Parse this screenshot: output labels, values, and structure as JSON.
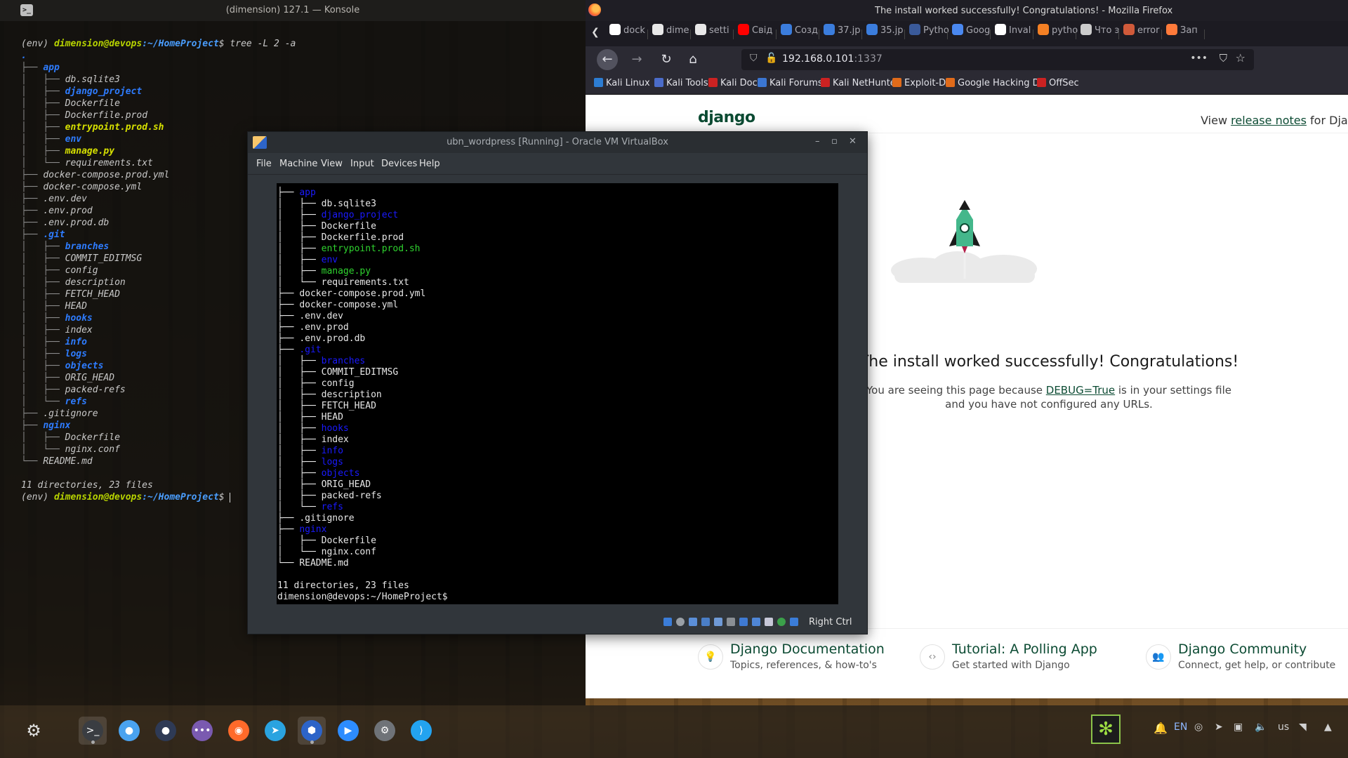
{
  "konsole": {
    "title": "(dimension) 127.1 — Konsole",
    "prompt_env": "(env) ",
    "prompt_user": "dimension@devops",
    "prompt_path": ":~/HomeProject",
    "prompt_sign": "$ ",
    "command": "tree -L 2 -a",
    "tree": [
      {
        "prefix": "",
        "name": ".",
        "kind": "dir"
      },
      {
        "prefix": "├── ",
        "name": "app",
        "kind": "dir"
      },
      {
        "prefix": "│   ├── ",
        "name": "db.sqlite3",
        "kind": "file"
      },
      {
        "prefix": "│   ├── ",
        "name": "django_project",
        "kind": "dir"
      },
      {
        "prefix": "│   ├── ",
        "name": "Dockerfile",
        "kind": "file"
      },
      {
        "prefix": "│   ├── ",
        "name": "Dockerfile.prod",
        "kind": "file"
      },
      {
        "prefix": "│   ├── ",
        "name": "entrypoint.prod.sh",
        "kind": "exec"
      },
      {
        "prefix": "│   ├── ",
        "name": "env",
        "kind": "dir"
      },
      {
        "prefix": "│   ├── ",
        "name": "manage.py",
        "kind": "exec"
      },
      {
        "prefix": "│   └── ",
        "name": "requirements.txt",
        "kind": "file"
      },
      {
        "prefix": "├── ",
        "name": "docker-compose.prod.yml",
        "kind": "file"
      },
      {
        "prefix": "├── ",
        "name": "docker-compose.yml",
        "kind": "file"
      },
      {
        "prefix": "├── ",
        "name": ".env.dev",
        "kind": "file"
      },
      {
        "prefix": "├── ",
        "name": ".env.prod",
        "kind": "file"
      },
      {
        "prefix": "├── ",
        "name": ".env.prod.db",
        "kind": "file"
      },
      {
        "prefix": "├── ",
        "name": ".git",
        "kind": "dir"
      },
      {
        "prefix": "│   ├── ",
        "name": "branches",
        "kind": "dir"
      },
      {
        "prefix": "│   ├── ",
        "name": "COMMIT_EDITMSG",
        "kind": "file"
      },
      {
        "prefix": "│   ├── ",
        "name": "config",
        "kind": "file"
      },
      {
        "prefix": "│   ├── ",
        "name": "description",
        "kind": "file"
      },
      {
        "prefix": "│   ├── ",
        "name": "FETCH_HEAD",
        "kind": "file"
      },
      {
        "prefix": "│   ├── ",
        "name": "HEAD",
        "kind": "file"
      },
      {
        "prefix": "│   ├── ",
        "name": "hooks",
        "kind": "dir"
      },
      {
        "prefix": "│   ├── ",
        "name": "index",
        "kind": "file"
      },
      {
        "prefix": "│   ├── ",
        "name": "info",
        "kind": "dir"
      },
      {
        "prefix": "│   ├── ",
        "name": "logs",
        "kind": "dir"
      },
      {
        "prefix": "│   ├── ",
        "name": "objects",
        "kind": "dir"
      },
      {
        "prefix": "│   ├── ",
        "name": "ORIG_HEAD",
        "kind": "file"
      },
      {
        "prefix": "│   ├── ",
        "name": "packed-refs",
        "kind": "file"
      },
      {
        "prefix": "│   └── ",
        "name": "refs",
        "kind": "dir"
      },
      {
        "prefix": "├── ",
        "name": ".gitignore",
        "kind": "file"
      },
      {
        "prefix": "├── ",
        "name": "nginx",
        "kind": "dir"
      },
      {
        "prefix": "│   ├── ",
        "name": "Dockerfile",
        "kind": "file"
      },
      {
        "prefix": "│   └── ",
        "name": "nginx.conf",
        "kind": "file"
      },
      {
        "prefix": "└── ",
        "name": "README.md",
        "kind": "file"
      }
    ],
    "summary": "11 directories, 23 files"
  },
  "firefox": {
    "title": "The install worked successfully! Congratulations! - Mozilla Firefox",
    "tabs": [
      {
        "label": "dock",
        "icon": "google-icon",
        "color": "#ffffff"
      },
      {
        "label": "dime",
        "icon": "github-icon",
        "color": "#e8e8e8"
      },
      {
        "label": "setti",
        "icon": "github-icon",
        "color": "#e8e8e8"
      },
      {
        "label": "Свід",
        "icon": "youtube-icon",
        "color": "#ff0000"
      },
      {
        "label": "Созд",
        "icon": "image-icon",
        "color": "#3b7ddd"
      },
      {
        "label": "37.jp",
        "icon": "image-icon",
        "color": "#3b7ddd"
      },
      {
        "label": "35.jp",
        "icon": "image-icon",
        "color": "#3b7ddd"
      },
      {
        "label": "Pytho",
        "icon": "python-icon",
        "color": "#3a5a9a"
      },
      {
        "label": "Goog",
        "icon": "translate-icon",
        "color": "#4a88f0"
      },
      {
        "label": "Inval",
        "icon": "google-icon",
        "color": "#ffffff"
      },
      {
        "label": "pytho",
        "icon": "stackoverflow-icon",
        "color": "#f48024"
      },
      {
        "label": "Что э",
        "icon": "page-icon",
        "color": "#cccccc"
      },
      {
        "label": "error",
        "icon": "plugin-icon",
        "color": "#d05a3a"
      },
      {
        "label": "Зап",
        "icon": "code-icon",
        "color": "#ff7a3a"
      }
    ],
    "url_host": "192.168.0.101",
    "url_port": ":1337",
    "bookmarks": [
      {
        "label": "Kali Linux",
        "icon": "kali-icon",
        "color": "#2d7dd2"
      },
      {
        "label": "Kali Tools",
        "icon": "kali-tools-icon",
        "color": "#4b6cc9"
      },
      {
        "label": "Kali Docs",
        "icon": "kali-docs-icon",
        "color": "#cc2222"
      },
      {
        "label": "Kali Forums",
        "icon": "kali-forums-icon",
        "color": "#3b76d2"
      },
      {
        "label": "Kali NetHunter",
        "icon": "nethunter-icon",
        "color": "#cc2222"
      },
      {
        "label": "Exploit-DB",
        "icon": "exploit-db-icon",
        "color": "#e16b1a"
      },
      {
        "label": "Google Hacking DB",
        "icon": "ghdb-icon",
        "color": "#e16b1a"
      },
      {
        "label": "OffSec",
        "icon": "offsec-icon",
        "color": "#cc2222"
      }
    ],
    "page": {
      "logo": "django",
      "release_prefix": "View ",
      "release_link": "release notes",
      "release_suffix": " for Djang",
      "heading": "The install worked successfully! Congratulations!",
      "body_prefix": "You are seeing this page because ",
      "body_link": "DEBUG=True",
      "body_suffix": " is in your settings file and you have not configured any URLs.",
      "cards": [
        {
          "title": "Django Documentation",
          "subtitle": "Topics, references, & how-to's",
          "icon": "lightbulb-icon"
        },
        {
          "title": "Tutorial: A Polling App",
          "subtitle": "Get started with Django",
          "icon": "code-brackets-icon"
        },
        {
          "title": "Django Community",
          "subtitle": "Connect, get help, or contribute",
          "icon": "people-icon"
        }
      ]
    }
  },
  "vbox": {
    "title": "ubn_wordpress [Running] - Oracle VM VirtualBox",
    "menu": [
      "File",
      "Machine",
      "View",
      "Input",
      "Devices",
      "Help"
    ],
    "tree": [
      {
        "prefix": "├── ",
        "name": "app",
        "kind": "dir"
      },
      {
        "prefix": "│   ├── ",
        "name": "db.sqlite3",
        "kind": "file"
      },
      {
        "prefix": "│   ├── ",
        "name": "django_project",
        "kind": "dir"
      },
      {
        "prefix": "│   ├── ",
        "name": "Dockerfile",
        "kind": "file"
      },
      {
        "prefix": "│   ├── ",
        "name": "Dockerfile.prod",
        "kind": "file"
      },
      {
        "prefix": "│   ├── ",
        "name": "entrypoint.prod.sh",
        "kind": "exec"
      },
      {
        "prefix": "│   ├── ",
        "name": "env",
        "kind": "dir"
      },
      {
        "prefix": "│   ├── ",
        "name": "manage.py",
        "kind": "exec"
      },
      {
        "prefix": "│   └── ",
        "name": "requirements.txt",
        "kind": "file"
      },
      {
        "prefix": "├── ",
        "name": "docker-compose.prod.yml",
        "kind": "file"
      },
      {
        "prefix": "├── ",
        "name": "docker-compose.yml",
        "kind": "file"
      },
      {
        "prefix": "├── ",
        "name": ".env.dev",
        "kind": "file"
      },
      {
        "prefix": "├── ",
        "name": ".env.prod",
        "kind": "file"
      },
      {
        "prefix": "├── ",
        "name": ".env.prod.db",
        "kind": "file"
      },
      {
        "prefix": "├── ",
        "name": ".git",
        "kind": "dir"
      },
      {
        "prefix": "│   ├── ",
        "name": "branches",
        "kind": "dir"
      },
      {
        "prefix": "│   ├── ",
        "name": "COMMIT_EDITMSG",
        "kind": "file"
      },
      {
        "prefix": "│   ├── ",
        "name": "config",
        "kind": "file"
      },
      {
        "prefix": "│   ├── ",
        "name": "description",
        "kind": "file"
      },
      {
        "prefix": "│   ├── ",
        "name": "FETCH_HEAD",
        "kind": "file"
      },
      {
        "prefix": "│   ├── ",
        "name": "HEAD",
        "kind": "file"
      },
      {
        "prefix": "│   ├── ",
        "name": "hooks",
        "kind": "dir"
      },
      {
        "prefix": "│   ├── ",
        "name": "index",
        "kind": "file"
      },
      {
        "prefix": "│   ├── ",
        "name": "info",
        "kind": "dir"
      },
      {
        "prefix": "│   ├── ",
        "name": "logs",
        "kind": "dir"
      },
      {
        "prefix": "│   ├── ",
        "name": "objects",
        "kind": "dir"
      },
      {
        "prefix": "│   ├── ",
        "name": "ORIG_HEAD",
        "kind": "file"
      },
      {
        "prefix": "│   ├── ",
        "name": "packed-refs",
        "kind": "file"
      },
      {
        "prefix": "│   └── ",
        "name": "refs",
        "kind": "dir"
      },
      {
        "prefix": "├── ",
        "name": ".gitignore",
        "kind": "file"
      },
      {
        "prefix": "├── ",
        "name": "nginx",
        "kind": "dir"
      },
      {
        "prefix": "│   ├── ",
        "name": "Dockerfile",
        "kind": "file"
      },
      {
        "prefix": "│   └── ",
        "name": "nginx.conf",
        "kind": "file"
      },
      {
        "prefix": "└── ",
        "name": "README.md",
        "kind": "file"
      }
    ],
    "summary": "11 directories, 23 files",
    "prompt": "dimension@devops:~/HomeProject$",
    "host_key": "Right Ctrl"
  },
  "taskbar": {
    "apps": [
      {
        "name": "konsole-icon",
        "glyph": ">_",
        "color": "#3a3d42"
      },
      {
        "name": "settings-toggle-icon",
        "glyph": "●",
        "color": "#4aa3f0"
      },
      {
        "name": "marble-icon",
        "glyph": "●",
        "color": "#2e3a55"
      },
      {
        "name": "chat-icon",
        "glyph": "•••",
        "color": "#7a5ab0"
      },
      {
        "name": "firefox-icon",
        "glyph": "◉",
        "color": "#ff6a2a"
      },
      {
        "name": "telegram-icon",
        "glyph": "➤",
        "color": "#2aa3e0"
      },
      {
        "name": "virtualbox-icon",
        "glyph": "⬢",
        "color": "#2d64c8"
      },
      {
        "name": "zoom-icon",
        "glyph": "▶",
        "color": "#2d8cff"
      },
      {
        "name": "steam-icon",
        "glyph": "⚙",
        "color": "#6f7378"
      },
      {
        "name": "vscode-icon",
        "glyph": "⟩",
        "color": "#23a3f0"
      }
    ],
    "tray_lang": "EN",
    "tray_layout": "us"
  }
}
